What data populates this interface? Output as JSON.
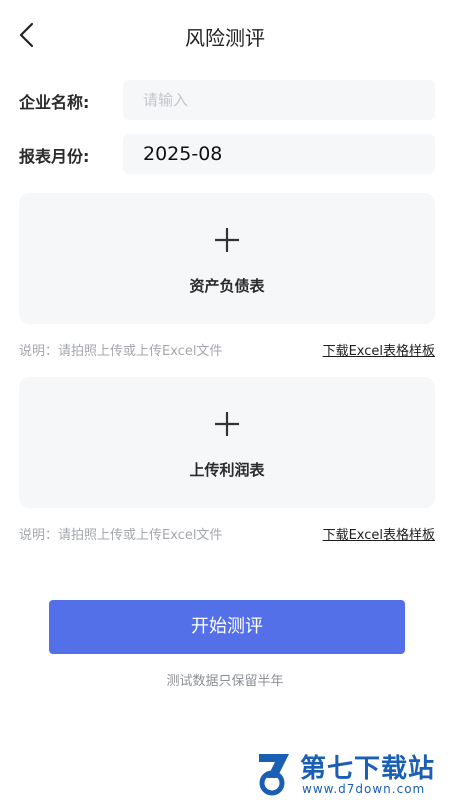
{
  "header": {
    "title": "风险测评",
    "back_icon": "chevron-left-icon"
  },
  "form": {
    "company_label": "企业名称:",
    "company_placeholder": "请输入",
    "company_value": "",
    "month_label": "报表月份:",
    "month_value": "2025-08"
  },
  "uploads": [
    {
      "label": "资产负债表",
      "icon": "plus-icon",
      "note": "说明：请拍照上传或上传Excel文件",
      "download_label": "下载Excel表格样板"
    },
    {
      "label": "上传利润表",
      "icon": "plus-icon",
      "note": "说明：请拍照上传或上传Excel文件",
      "download_label": "下载Excel表格样板"
    }
  ],
  "actions": {
    "start_label": "开始测评",
    "footer_note": "测试数据只保留半年"
  },
  "watermark": {
    "title": "第七下载站",
    "url": "www.d7down.com"
  },
  "colors": {
    "primary": "#5470e9",
    "card_bg": "#f6f7f9",
    "muted_text": "#a4a7ad",
    "watermark": "#1a5fb4"
  }
}
